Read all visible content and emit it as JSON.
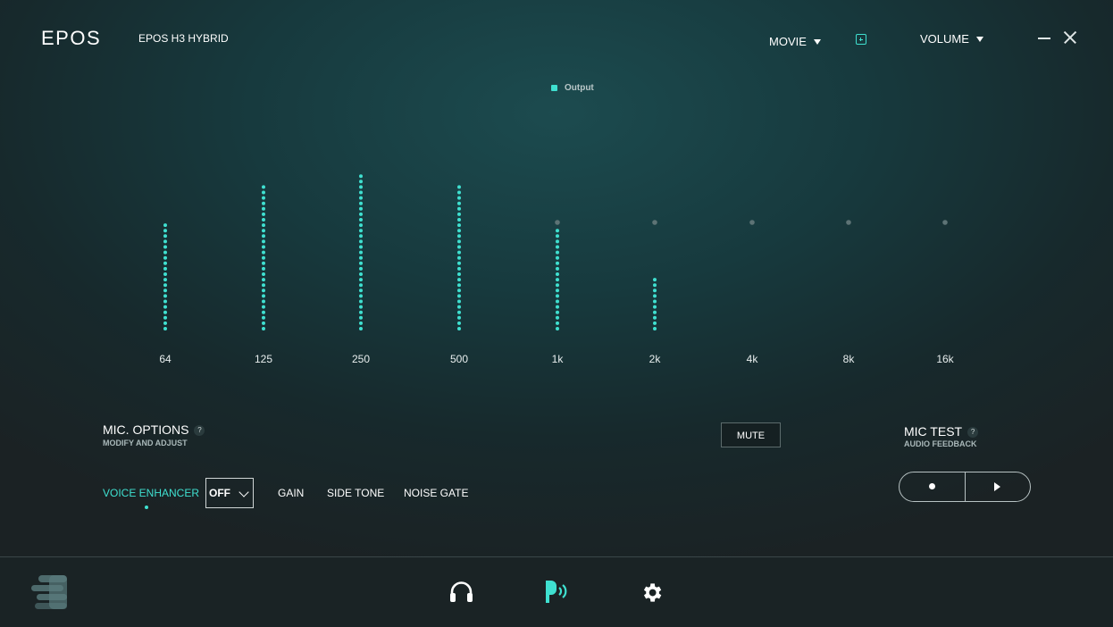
{
  "app": {
    "logo": "EPOS",
    "device_name": "EPOS H3 HYBRID"
  },
  "header": {
    "preset": {
      "label": "MOVIE"
    },
    "add_preset_icon": "plus-square-icon",
    "volume": {
      "label": "VOLUME"
    }
  },
  "equalizer": {
    "legend": "Output",
    "accent_color": "#3fe0d0",
    "bands": [
      {
        "label": "64",
        "level": 0.0
      },
      {
        "label": "125",
        "level": 0.24
      },
      {
        "label": "250",
        "level": 0.33
      },
      {
        "label": "500",
        "level": 0.24
      },
      {
        "label": "1k",
        "level": -0.06
      },
      {
        "label": "2k",
        "level": -0.53
      },
      {
        "label": "4k",
        "level": -1
      },
      {
        "label": "8k",
        "level": -1
      },
      {
        "label": "16k",
        "level": -1
      }
    ]
  },
  "mic_options": {
    "title": "MIC. OPTIONS",
    "subtitle": "MODIFY AND ADJUST",
    "help": "?",
    "mute_label": "MUTE",
    "tabs": [
      "VOICE ENHANCER",
      "GAIN",
      "SIDE TONE",
      "NOISE GATE"
    ],
    "voice_enhancer_value": "OFF"
  },
  "mic_test": {
    "title": "MIC TEST",
    "subtitle": "AUDIO FEEDBACK",
    "help": "?"
  },
  "footer": {
    "icons": [
      "menu-stack-icon",
      "headphones-icon",
      "microphone-voice-icon",
      "gear-icon"
    ]
  }
}
